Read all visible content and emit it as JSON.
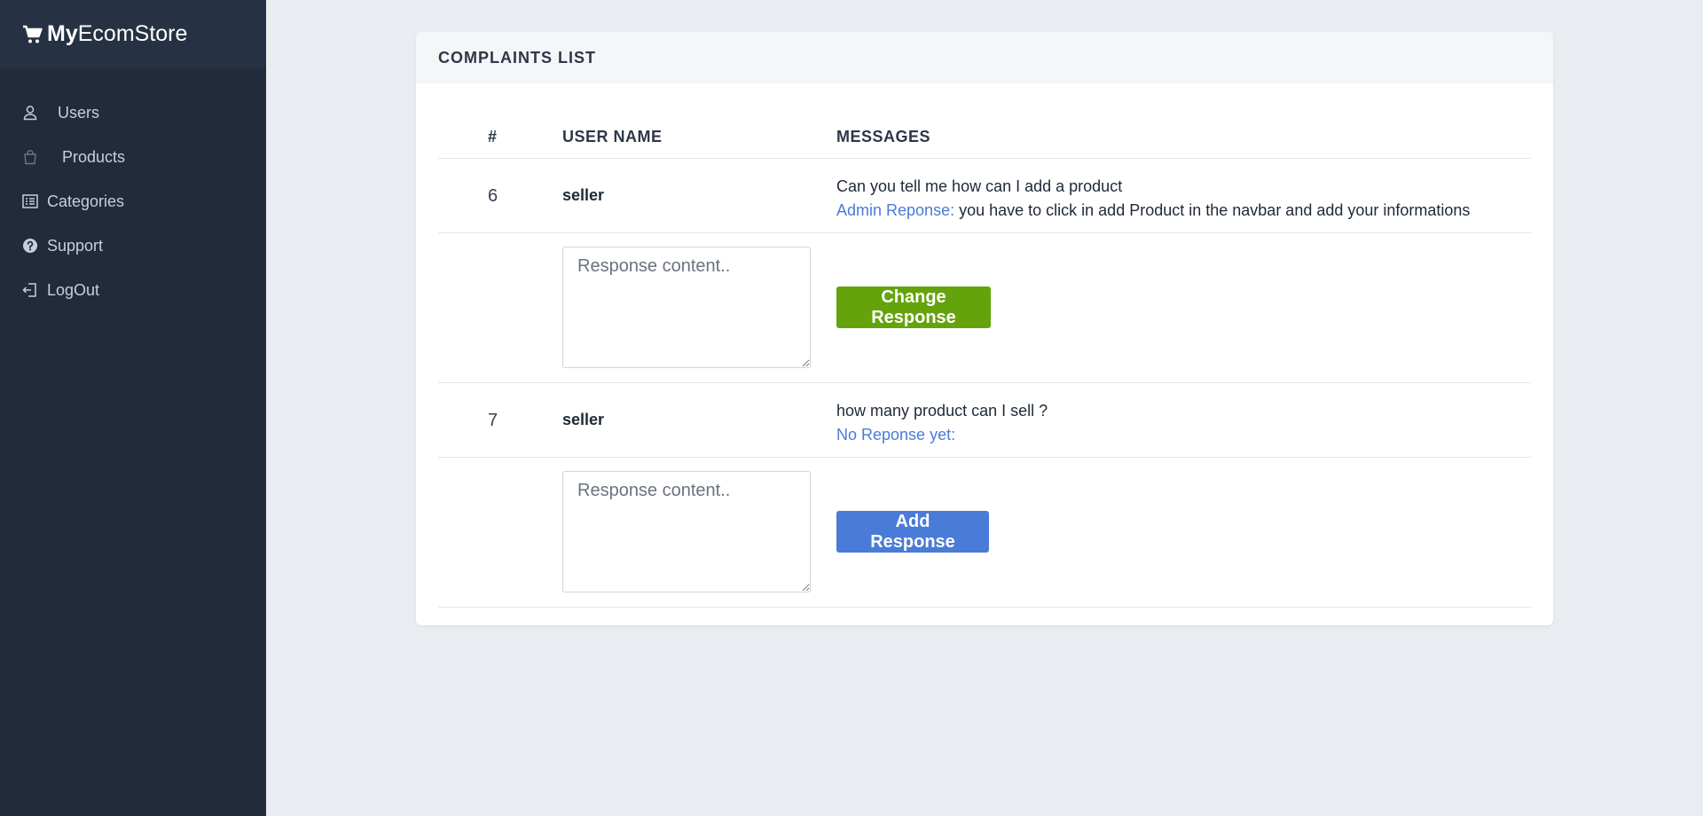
{
  "brand": {
    "bold": "My",
    "rest": "EcomStore"
  },
  "sidebar": {
    "items": [
      {
        "label": "Users",
        "icon": "user-icon"
      },
      {
        "label": "Products",
        "icon": "shopping-bag-icon"
      },
      {
        "label": "Categories",
        "icon": "list-icon"
      },
      {
        "label": "Support",
        "icon": "question-circle-icon"
      },
      {
        "label": "LogOut",
        "icon": "logout-icon"
      }
    ]
  },
  "complaints": {
    "title": "COMPLAINTS LIST",
    "columns": [
      "#",
      "USER NAME",
      "MESSAGES"
    ],
    "rows": [
      {
        "id": "6",
        "user": "seller",
        "message": "Can you tell me how can I add a product",
        "response_label": "Admin Reponse:",
        "response_text": "you have to click in add Product in the navbar and add your informations",
        "input_placeholder": "Response content..",
        "button_label": "Change Response"
      },
      {
        "id": "7",
        "user": "seller",
        "message": "how many product can I sell ?",
        "response_label": "No Reponse yet:",
        "response_text": "",
        "input_placeholder": "Response content..",
        "button_label": "Add Response"
      }
    ]
  },
  "colors": {
    "sidebar": "#212b3b",
    "accent": "#4a7bd8",
    "change_button": "#65a30d",
    "add_button": "#4a7bd8"
  }
}
